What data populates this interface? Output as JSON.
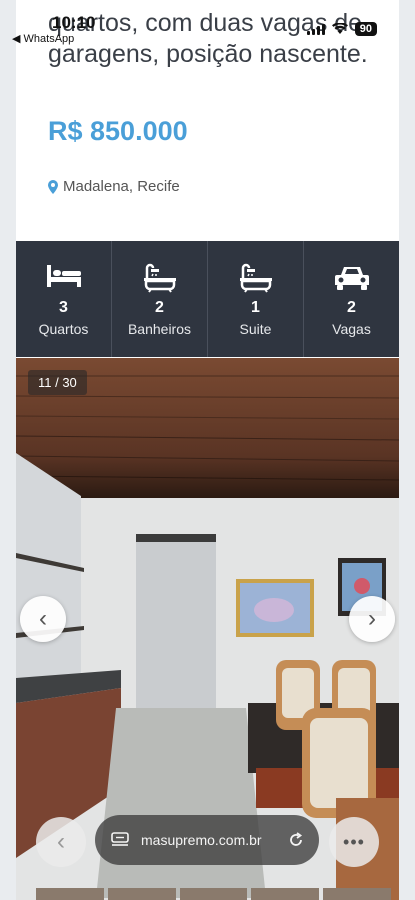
{
  "status": {
    "time": "10:10",
    "back_app": "◀ WhatsApp",
    "battery": "90"
  },
  "listing": {
    "description": "quartos, com duas vagas de garagens, posição nascente.",
    "price": "R$ 850.000",
    "location": "Madalena, Recife",
    "features": [
      {
        "icon": "bed-icon",
        "value": "3",
        "label": "Quartos"
      },
      {
        "icon": "bathtub-icon",
        "value": "2",
        "label": "Banheiros"
      },
      {
        "icon": "bathtub-icon",
        "value": "1",
        "label": "Suite"
      },
      {
        "icon": "car-icon",
        "value": "2",
        "label": "Vagas"
      }
    ]
  },
  "gallery": {
    "counter": "11 / 30"
  },
  "browser": {
    "url": "masupremo.com.br"
  },
  "colors": {
    "price": "#4a9fd8",
    "features_bg": "#2f3540"
  }
}
